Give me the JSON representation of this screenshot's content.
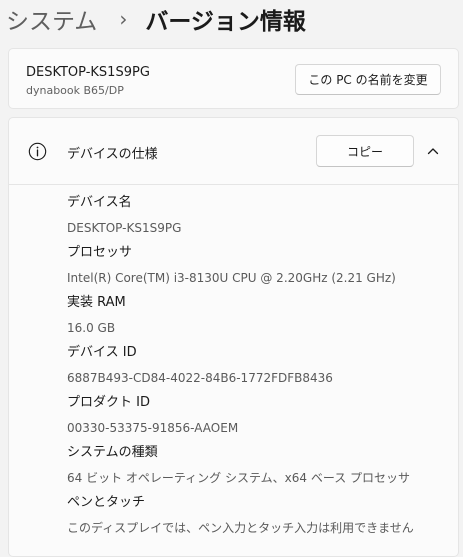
{
  "breadcrumb": {
    "parent": "システム",
    "separator": "›",
    "current": "バージョン情報"
  },
  "device": {
    "name": "DESKTOP-KS1S9PG",
    "model": "dynabook B65/DP",
    "rename_button": "この PC の名前を変更"
  },
  "device_specs": {
    "title": "デバイスの仕様",
    "copy_button": "コピー",
    "rows": [
      {
        "label": "デバイス名",
        "value": "DESKTOP-KS1S9PG"
      },
      {
        "label": "プロセッサ",
        "value": "Intel(R) Core(TM) i3-8130U CPU @ 2.20GHz (2.21 GHz)"
      },
      {
        "label": "実装 RAM",
        "value": "16.0 GB"
      },
      {
        "label": "デバイス ID",
        "value": "6887B493-CD84-4022-84B6-1772FDFB8436"
      },
      {
        "label": "プロダクト ID",
        "value": "00330-53375-91856-AAOEM"
      },
      {
        "label": "システムの種類",
        "value": "64 ビット オペレーティング システム、x64 ベース プロセッサ"
      },
      {
        "label": "ペンとタッチ",
        "value": "このディスプレイでは、ペン入力とタッチ入力は利用できません"
      }
    ]
  },
  "icons": {
    "info": "info-icon",
    "expand": "chevron-up-icon"
  }
}
